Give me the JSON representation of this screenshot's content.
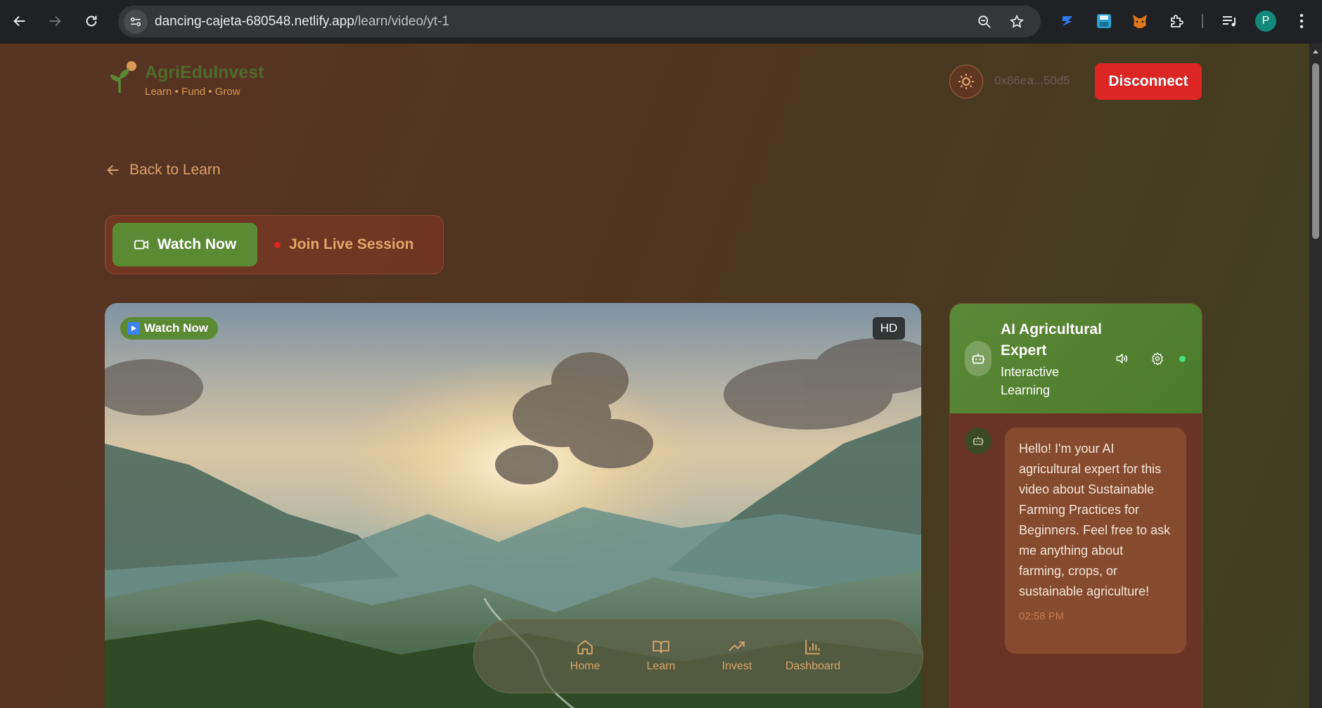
{
  "browser": {
    "url_host": "dancing-cajeta-680548.netlify.app",
    "url_path": "/learn/video/yt-1",
    "profile_initial": "P"
  },
  "header": {
    "brand": "AgriEduInvest",
    "tagline": "Learn • Fund • Grow",
    "wallet_address": "0x86ea...50d5",
    "disconnect_label": "Disconnect"
  },
  "back_link": {
    "label": "Back to Learn"
  },
  "mode_tabs": {
    "watch_label": "Watch Now",
    "live_label": "Join Live Session",
    "active": "watch"
  },
  "video": {
    "badge_label": "Watch Now",
    "quality_badge": "HD"
  },
  "chat": {
    "title": "AI Agricultural Expert",
    "subtitle": "Interactive Learning",
    "messages": [
      {
        "sender": "bot",
        "text": "Hello! I'm your AI agricultural expert for this video about Sustainable Farming Practices for Beginners. Feel free to ask me anything about farming, crops, or sustainable agriculture!",
        "time": "02:58 PM"
      }
    ]
  },
  "bottom_nav": {
    "items": [
      {
        "label": "Home",
        "icon": "home-icon"
      },
      {
        "label": "Learn",
        "icon": "book-icon"
      },
      {
        "label": "Invest",
        "icon": "trending-up-icon"
      },
      {
        "label": "Dashboard",
        "icon": "bar-chart-icon"
      }
    ]
  },
  "colors": {
    "accent_green": "#5b8a35",
    "danger_red": "#dc2626",
    "accent_orange": "#d9a06a"
  }
}
